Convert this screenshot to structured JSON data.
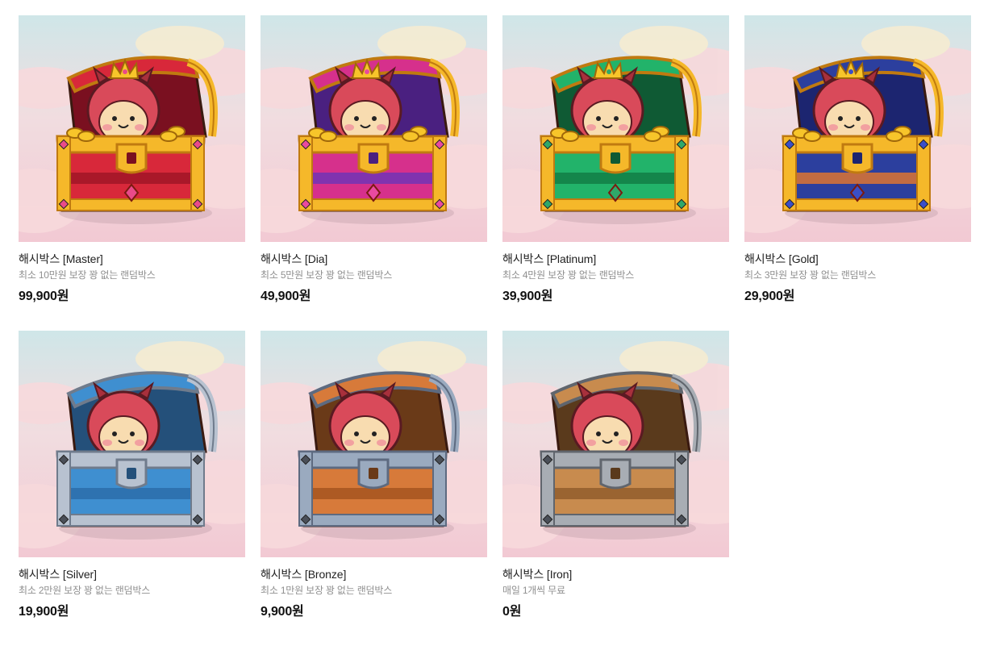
{
  "products": [
    {
      "name": "해시박스 [Master]",
      "description": "최소 10만원 보장 꽝 없는 랜덤박스",
      "price": "99,900원",
      "tier": "master",
      "colors": {
        "body": "#d8283a",
        "bodyDark": "#9e1426",
        "trim": "#f5b82a",
        "trimDark": "#c07a10",
        "inner": "#7a1020",
        "gem": "#e94a8a"
      }
    },
    {
      "name": "해시박스 [Dia]",
      "description": "최소 5만원 보장 꽝 없는 랜덤박스",
      "price": "49,900원",
      "tier": "dia",
      "colors": {
        "body": "#d6308c",
        "bodyDark": "#6a35b8",
        "trim": "#f5b82a",
        "trimDark": "#c07a10",
        "inner": "#4a2080",
        "gem": "#e94aa0"
      }
    },
    {
      "name": "해시박스 [Platinum]",
      "description": "최소 4만원 보장 꽝 없는 랜덤박스",
      "price": "39,900원",
      "tier": "platinum",
      "colors": {
        "body": "#22b36a",
        "bodyDark": "#127a44",
        "trim": "#f5b82a",
        "trimDark": "#c07a10",
        "inner": "#0f5a34",
        "gem": "#2ea86a"
      }
    },
    {
      "name": "해시박스 [Gold]",
      "description": "최소 3만원 보장 꽝 없는 랜덤박스",
      "price": "29,900원",
      "tier": "gold",
      "colors": {
        "body": "#2c3f9e",
        "bodyDark": "#e8782a",
        "trim": "#f5b82a",
        "trimDark": "#c07a10",
        "inner": "#1c2570",
        "gem": "#3a4fc8"
      }
    },
    {
      "name": "해시박스 [Silver]",
      "description": "최소 2만원 보장 꽝 없는 랜덤박스",
      "price": "19,900원",
      "tier": "silver",
      "colors": {
        "body": "#3f8fd0",
        "bodyDark": "#2a6aa8",
        "trim": "#b8c2d0",
        "trimDark": "#6f7b8c",
        "inner": "#24507a",
        "gem": "#4a9ad8"
      }
    },
    {
      "name": "해시박스 [Bronze]",
      "description": "최소 1만원 보장 꽝 없는 랜덤박스",
      "price": "9,900원",
      "tier": "bronze",
      "colors": {
        "body": "#d77a3a",
        "bodyDark": "#a2521e",
        "trim": "#9aaabf",
        "trimDark": "#5d6a80",
        "inner": "#6a3a18",
        "gem": "#c86a2a"
      }
    },
    {
      "name": "해시박스 [Iron]",
      "description": "매일 1개씩 무료",
      "price": "0원",
      "tier": "iron",
      "colors": {
        "body": "#c88b4e",
        "bodyDark": "#8e5a2a",
        "trim": "#a8adb4",
        "trimDark": "#60656d",
        "inner": "#5a3a1c",
        "gem": "#b07a42"
      }
    }
  ]
}
